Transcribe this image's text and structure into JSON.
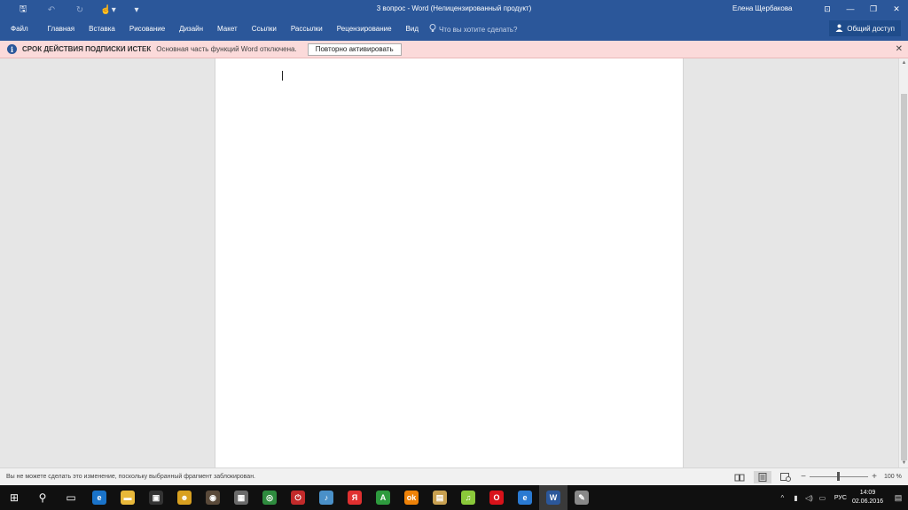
{
  "window": {
    "title": "3 вопрос - Word (Нелицензированный продукт)",
    "user": "Елена Щербакова",
    "qat": [
      {
        "name": "save-icon",
        "glyph": "🖫"
      },
      {
        "name": "undo-icon",
        "glyph": "↶"
      },
      {
        "name": "redo-icon",
        "glyph": "↻"
      },
      {
        "name": "touch-mode-icon",
        "glyph": "☝▾"
      },
      {
        "name": "customize-qat-icon",
        "glyph": "▾"
      }
    ],
    "controls": {
      "ribbon_display": "⊡",
      "minimize": "—",
      "restore": "❐",
      "close": "✕"
    }
  },
  "ribbon": {
    "tabs": [
      "Файл",
      "Главная",
      "Вставка",
      "Рисование",
      "Дизайн",
      "Макет",
      "Ссылки",
      "Рассылки",
      "Рецензирование",
      "Вид"
    ],
    "tell_me": "Что вы хотите сделать?",
    "share": "Общий доступ"
  },
  "message_bar": {
    "title": "СРОК ДЕЙСТВИЯ ПОДПИСКИ ИСТЕК",
    "text": "Основная часть функций Word отключена.",
    "button": "Повторно активировать",
    "close": "✕"
  },
  "status_bar": {
    "text": "Вы не можете сделать это изменение, поскольку выбранный фрагмент заблокирован.",
    "zoom_minus": "−",
    "zoom_plus": "+",
    "zoom_percent": "100 %",
    "zoom_value": 100
  },
  "taskbar": {
    "apps": [
      {
        "name": "start-icon",
        "glyph": "⊞",
        "bg": "transparent"
      },
      {
        "name": "search-icon",
        "glyph": "⚲",
        "bg": "transparent"
      },
      {
        "name": "task-view-icon",
        "glyph": "▭",
        "bg": "transparent"
      },
      {
        "name": "edge-icon",
        "glyph": "e",
        "bg": "#1a73c9"
      },
      {
        "name": "file-explorer-icon",
        "glyph": "▬",
        "bg": "#e8b83a"
      },
      {
        "name": "store-icon",
        "glyph": "▣",
        "bg": "#333"
      },
      {
        "name": "game-app-icon",
        "glyph": "☻",
        "bg": "#d8a020"
      },
      {
        "name": "media-app-icon",
        "glyph": "◉",
        "bg": "#5a4a3a"
      },
      {
        "name": "photo-app-icon",
        "glyph": "▦",
        "bg": "#6a6a6a"
      },
      {
        "name": "chrome-icon",
        "glyph": "◎",
        "bg": "#2e8b3e"
      },
      {
        "name": "power-app-icon",
        "glyph": "⏻",
        "bg": "#c22a2a"
      },
      {
        "name": "audio-app-icon",
        "glyph": "♪",
        "bg": "#4a90c8"
      },
      {
        "name": "yandex-icon",
        "glyph": "Я",
        "bg": "#e03030"
      },
      {
        "name": "adobe-app-icon",
        "glyph": "A",
        "bg": "#2e9a3e"
      },
      {
        "name": "odnoklassniki-icon",
        "glyph": "ok",
        "bg": "#ee8208"
      },
      {
        "name": "notes-app-icon",
        "glyph": "▤",
        "bg": "#c8a050"
      },
      {
        "name": "music-app-icon",
        "glyph": "♫",
        "bg": "#8ac83a"
      },
      {
        "name": "opera-icon",
        "glyph": "O",
        "bg": "#d8121a"
      },
      {
        "name": "internet-explorer-icon",
        "glyph": "e",
        "bg": "#2a7ad2"
      },
      {
        "name": "word-icon",
        "glyph": "W",
        "bg": "#2b579a",
        "active": true
      },
      {
        "name": "tool-app-icon",
        "glyph": "✎",
        "bg": "#888"
      }
    ],
    "tray_icons": [
      {
        "name": "show-hidden-icon",
        "glyph": "^"
      },
      {
        "name": "network-icon",
        "glyph": "▮"
      },
      {
        "name": "volume-icon",
        "glyph": "◁)"
      },
      {
        "name": "battery-icon",
        "glyph": "▭"
      }
    ],
    "language": "РУС",
    "time": "14:09",
    "date": "02.06.2016",
    "notifications": "▤"
  }
}
